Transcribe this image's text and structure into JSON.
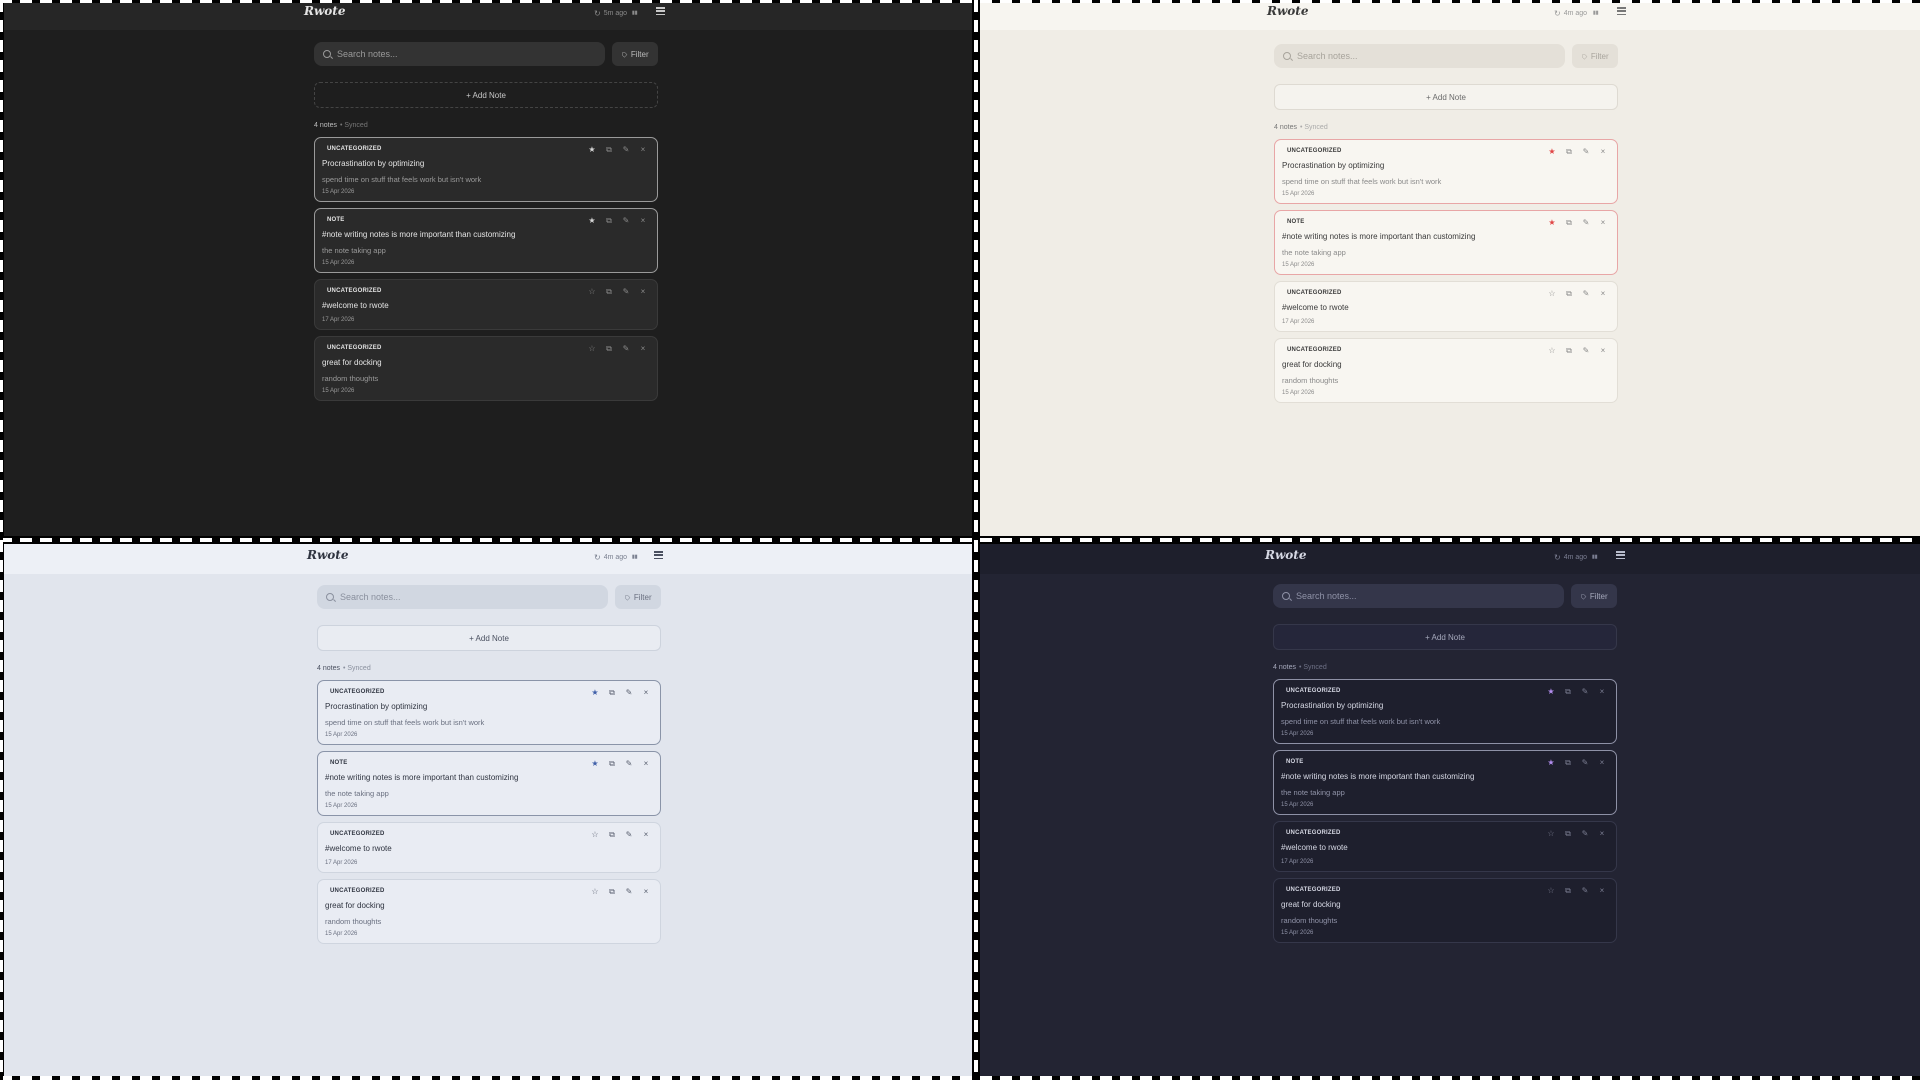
{
  "app": {
    "logo": "Rwote",
    "sync_icon": "refresh-icon",
    "stats_icon": "bar-chart-icon",
    "menu_icon": "hamburger-menu-icon",
    "search_placeholder": "Search notes...",
    "filter_label": "Filter",
    "add_note_label": "+ Add Note",
    "notes_count": "4 notes",
    "synced_label": "• Synced"
  },
  "panels": {
    "dark": {
      "theme": "dark",
      "sync_time": "5m ago",
      "star_color": "#d6d6d6"
    },
    "light": {
      "theme": "light",
      "sync_time": "4m ago",
      "star_color": "#e04545"
    },
    "blue": {
      "theme": "blue-gray",
      "sync_time": "4m ago",
      "star_color": "#3f5fa8"
    },
    "navy": {
      "theme": "navy",
      "sync_time": "4m ago",
      "star_color": "#b48ef0"
    }
  },
  "notes": [
    {
      "category": "UNCATEGORIZED",
      "title": "Procrastination by optimizing",
      "body": "spend time on stuff that feels work but isn't work",
      "date": "15 Apr 2026",
      "starred": true
    },
    {
      "category": "NOTE",
      "title": "#note writing notes is more important than customizing",
      "body": "the note taking app",
      "date": "15 Apr 2026",
      "starred": true
    },
    {
      "category": "UNCATEGORIZED",
      "title": "#welcome to rwote",
      "body": "",
      "date": "17 Apr 2026",
      "starred": false
    },
    {
      "category": "UNCATEGORIZED",
      "title": "great for docking",
      "body": "random thoughts",
      "date": "15 Apr 2026",
      "starred": false
    }
  ],
  "card_actions": {
    "star_on": "★",
    "star_off": "☆",
    "duplicate": "⧉",
    "edit": "✎",
    "delete": "×"
  }
}
